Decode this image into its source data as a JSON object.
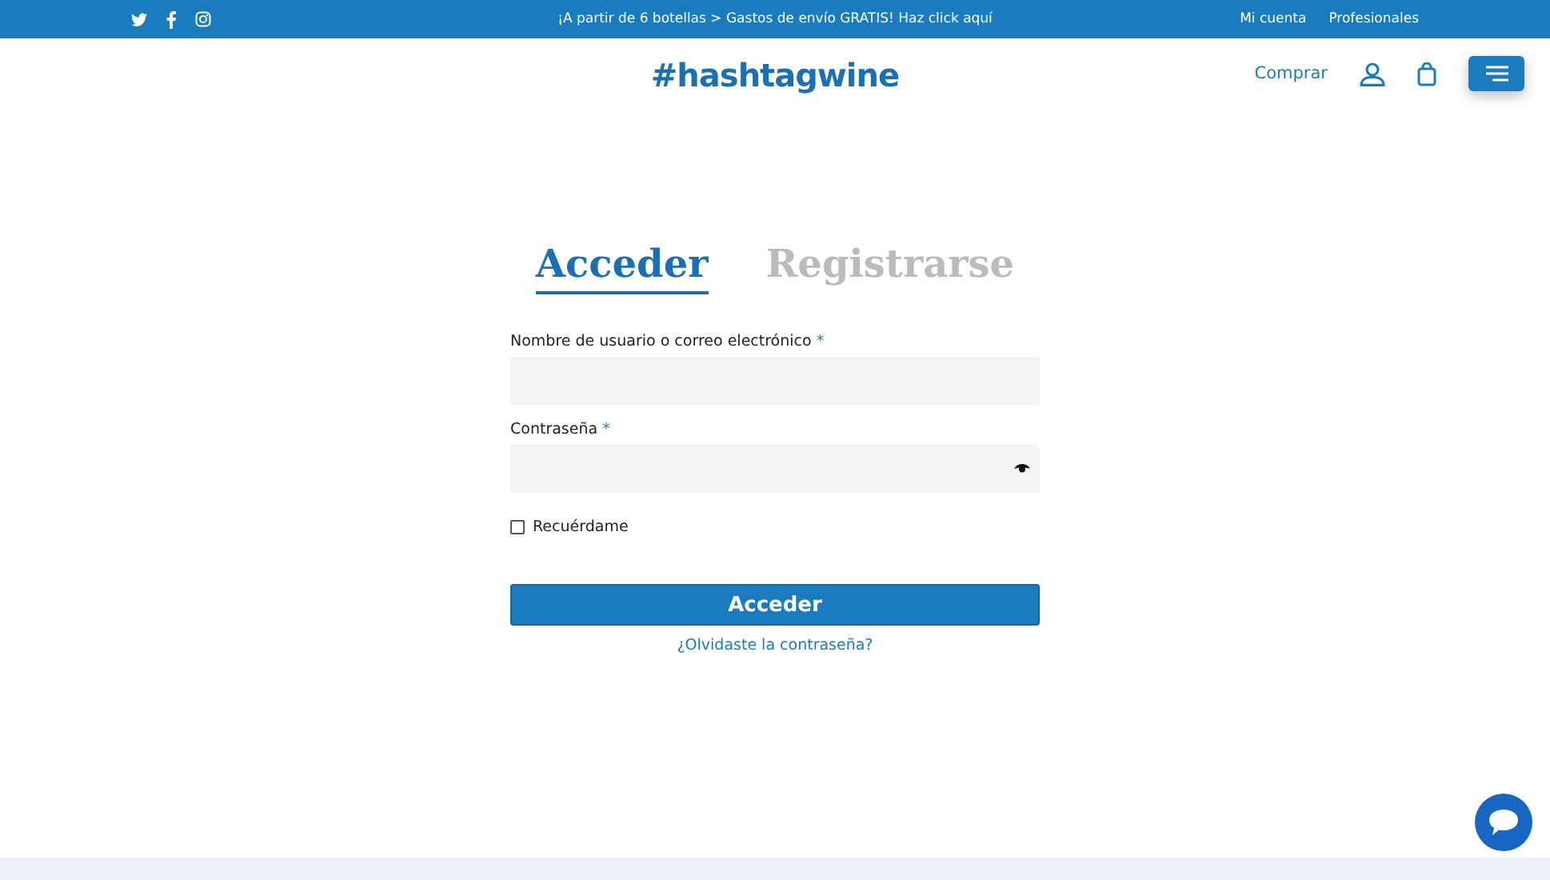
{
  "top_bar": {
    "social": [
      {
        "kind": "twitter"
      },
      {
        "kind": "facebook"
      },
      {
        "kind": "instagram"
      }
    ],
    "promo": "¡A partir de 6 botellas > Gastos de envío GRATIS! Haz click aquí",
    "links": [
      "Mi cuenta",
      "Profesionales"
    ]
  },
  "header": {
    "logo": "#hashtagwine",
    "nav_link": "Comprar"
  },
  "tabs": [
    {
      "label": "Acceder",
      "selected": true
    },
    {
      "label": "Registrarse",
      "selected": false
    }
  ],
  "fields": [
    {
      "label": "Nombre de usuario o correo electrónico",
      "required_mark": "*",
      "kind": "text"
    },
    {
      "label": "Contraseña",
      "required_mark": "*",
      "kind": "password"
    }
  ],
  "remember": {
    "label": "Recuérdame",
    "checked": false
  },
  "submit": "Acceder",
  "forgot_link": "¿Olvidaste la contraseña?"
}
